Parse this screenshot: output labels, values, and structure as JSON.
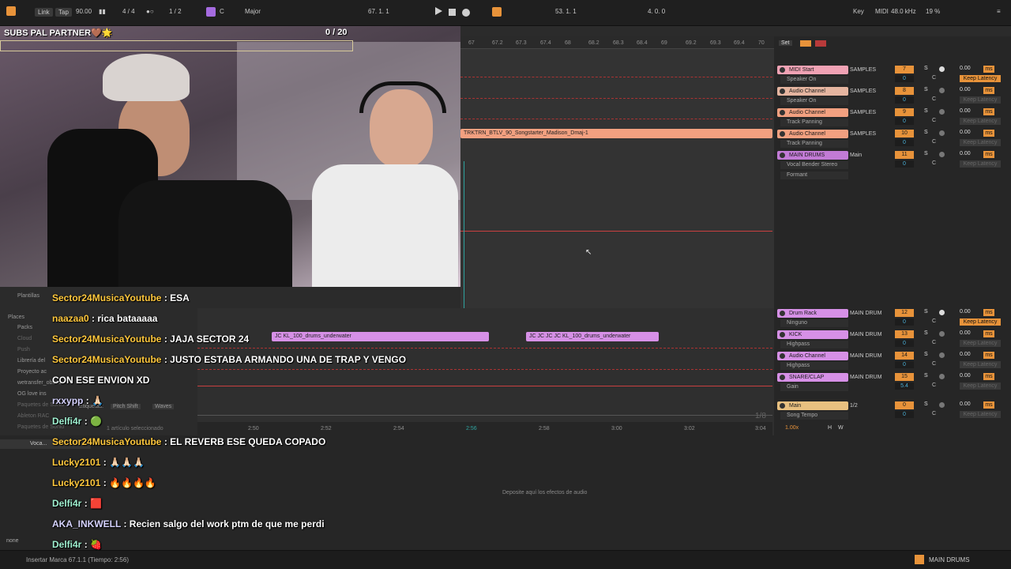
{
  "topbar": {
    "link": "Link",
    "tap": "Tap",
    "tempo": "90.00",
    "sig": "4 / 4",
    "quant": "1 / 2",
    "key": "C",
    "scale": "Major",
    "pos1": "67.  1.  1",
    "pos2": "53.  1.  1",
    "pos3": "4.  0.  0",
    "key_label": "Key",
    "midi": "MIDI",
    "rate": "48.0 kHz",
    "cpu": "19 %"
  },
  "overlay": {
    "subs": "SUBS PAL PARTNER🤎🌟",
    "count": "0  / 20"
  },
  "ruler": {
    "ticks": [
      "67",
      "67.2",
      "67.3",
      "67.4",
      "68",
      "68.2",
      "68.3",
      "68.4",
      "69",
      "69.2",
      "69.3",
      "69.4",
      "70"
    ],
    "set": "Set"
  },
  "clip": {
    "name": "TRKTRN_BTLV_90_Songstarter_Madison_Dmaj-1"
  },
  "drum_clip": {
    "name1": "JC  KL_100_drums_underwater",
    "name2": "JC  JC  JC  JC  KL_100_drums_underwater"
  },
  "timeline": {
    "times": [
      "2:50",
      "2:52",
      "2:54",
      "2:56",
      "2:58",
      "3:00",
      "3:02",
      "3:04"
    ],
    "page": "1/8"
  },
  "mixer": {
    "tracks": [
      {
        "name": "MIDI Start",
        "sub": "Speaker On",
        "io": "SAMPLES",
        "num": "7",
        "vol": "0",
        "del": "0.00",
        "lat": "Keep Latency",
        "color": "#f0a2b4",
        "on": true
      },
      {
        "name": "Audio Channel",
        "sub": "Speaker On",
        "io": "SAMPLES",
        "num": "8",
        "vol": "0",
        "del": "0.00",
        "lat": "Keep Latency",
        "color": "#e5b5a0",
        "on": false
      },
      {
        "name": "Audio Channel",
        "sub": "Track Panning",
        "io": "SAMPLES",
        "num": "9",
        "vol": "0",
        "del": "0.00",
        "lat": "Keep Latency",
        "color": "#f2a080",
        "on": false
      },
      {
        "name": "Audio Channel",
        "sub": "Track Panning",
        "io": "SAMPLES",
        "num": "10",
        "vol": "0",
        "del": "0.00",
        "lat": "Keep Latency",
        "color": "#f2a080",
        "on": false
      },
      {
        "name": "MAIN DRUMS",
        "sub": "Vocal Bender Stereo",
        "sub2": "Formant",
        "io": "Main",
        "num": "11",
        "vol": "0",
        "del": "0.00",
        "lat": "Keep Latency",
        "color": "#c27bd6",
        "on": false
      },
      {
        "name": "Drum Rack",
        "sub": "Ninguno",
        "io": "MAIN DRUM",
        "num": "12",
        "vol": "0",
        "del": "0.00",
        "lat": "Keep Latency",
        "color": "#d690e6",
        "on": true
      },
      {
        "name": "KICK",
        "sub": "Highpass",
        "io": "MAIN DRUM",
        "num": "13",
        "vol": "0",
        "del": "0.00",
        "lat": "Keep Latency",
        "color": "#d690e6",
        "on": false
      },
      {
        "name": "Audio Channel",
        "sub": "Highpass",
        "io": "MAIN DRUM",
        "num": "14",
        "vol": "0",
        "del": "0.00",
        "lat": "Keep Latency",
        "color": "#d690e6",
        "on": false
      },
      {
        "name": "SNARE/CLAP",
        "sub": "Gain",
        "io": "MAIN DRUM",
        "num": "15",
        "vol": "5.4",
        "del": "0.00",
        "lat": "Keep Latency",
        "color": "#d690e6",
        "on": false
      },
      {
        "name": "Main",
        "sub": "Song Tempo",
        "io": "1/2",
        "num": "0",
        "vol": "0",
        "del": "0.00",
        "lat": "Keep Latency",
        "color": "#e8c080",
        "on": false
      }
    ],
    "zoom": "1.00x",
    "h": "H",
    "w": "W"
  },
  "browser": {
    "items": [
      "Plantillas",
      "Places",
      "Packs",
      "Cloud",
      "Push",
      "Librería del",
      "Proyecto ac",
      "wetransfer_obses",
      "OG love ins",
      "Paquetes de Sonid",
      "Ableton RAC",
      "Paquetes de Sonid"
    ],
    "tags": "Etiquetas:",
    "tag1": "Pitch Shift",
    "tag2": "Waves",
    "selected": "1 artículo seleccionado",
    "vocal": "Voca...",
    "none": "none"
  },
  "chat": [
    {
      "user": "Sector24MusicaYoutube",
      "msg": "ESA"
    },
    {
      "user": "naazaa0",
      "msg": "rica bataaaaa"
    },
    {
      "user": "Sector24MusicaYoutube",
      "msg": "JAJA SECTOR 24"
    },
    {
      "user": "Sector24MusicaYoutube",
      "msg": "JUSTO ESTABA ARMANDO UNA DE TRAP Y VENGO"
    },
    {
      "user": "",
      "msg": "CON ESE ENVION XD"
    },
    {
      "user": "rxxypp",
      "msg": "🙏🏻"
    },
    {
      "user": "Delfi4r",
      "msg": "🟢"
    },
    {
      "user": "Sector24MusicaYoutube",
      "msg": "EL REVERB ESE QUEDA COPADO"
    },
    {
      "user": "Lucky2101",
      "msg": "🙏🏻🙏🏻🙏🏻"
    },
    {
      "user": "Lucky2101",
      "msg": "🔥🔥🔥🔥"
    },
    {
      "user": "Delfi4r",
      "msg": "🟥"
    },
    {
      "user": "AKA_INKWELL",
      "msg": "Recien salgo del work ptm de que me perdi"
    },
    {
      "user": "Delfi4r",
      "msg": "🍓"
    }
  ],
  "device": {
    "drop": "Deposite aquí los efectos de audio"
  },
  "status": {
    "text": "Insertar Marca 67.1.1 (Tiempo: 2:56)",
    "track": "MAIN DRUMS"
  }
}
